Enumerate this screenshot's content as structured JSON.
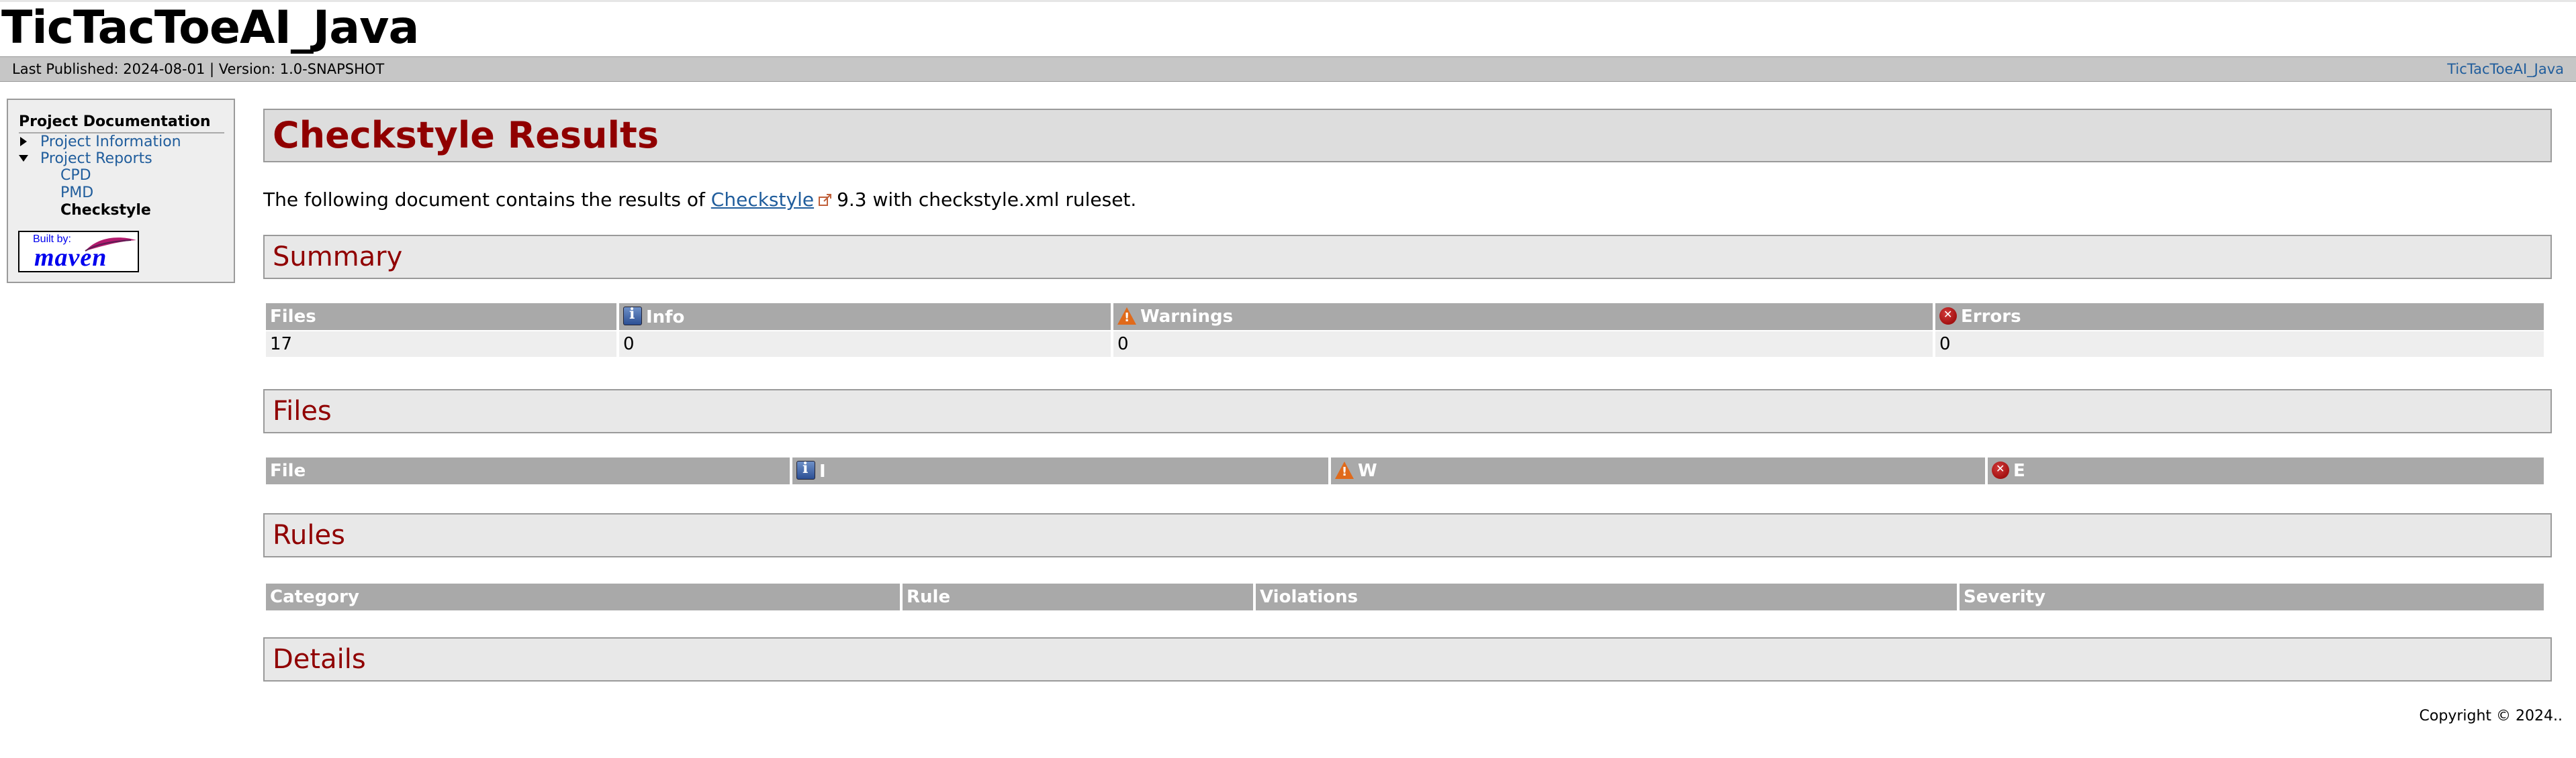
{
  "site": {
    "title": "TicTacToeAI_Java"
  },
  "breadcrumbs": {
    "published": "Last Published: 2024-08-01 | Version: 1.0-SNAPSHOT",
    "right_link": "TicTacToeAI_Java"
  },
  "nav": {
    "heading": "Project Documentation",
    "items": [
      {
        "label": "Project Information"
      },
      {
        "label": "Project Reports"
      },
      {
        "label": "CPD"
      },
      {
        "label": "PMD"
      },
      {
        "label": "Checkstyle"
      }
    ],
    "badge": {
      "built_by": "Built by:",
      "name": "maven"
    }
  },
  "main": {
    "title": "Checkstyle Results",
    "intro": {
      "before": "The following document contains the results of",
      "link": "Checkstyle",
      "after": "9.3 with checkstyle.xml ruleset."
    },
    "summary": {
      "heading": "Summary",
      "headers": [
        "Files",
        "Info",
        "Warnings",
        "Errors"
      ],
      "row": [
        "17",
        "0",
        "0",
        "0"
      ]
    },
    "files": {
      "heading": "Files",
      "headers": [
        "File",
        "I",
        "W",
        "E"
      ]
    },
    "rules": {
      "heading": "Rules",
      "headers": [
        "Category",
        "Rule",
        "Violations",
        "Severity"
      ]
    },
    "details": {
      "heading": "Details"
    }
  },
  "footer": {
    "copyright": "Copyright © 2024.."
  }
}
